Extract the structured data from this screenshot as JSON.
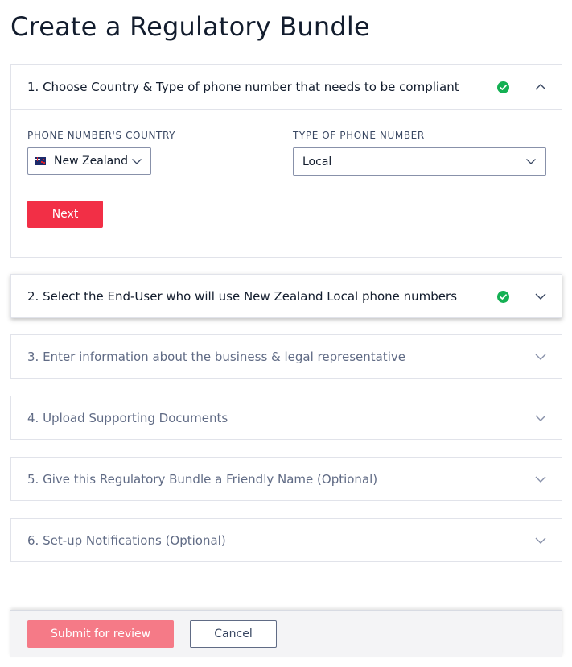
{
  "page": {
    "title": "Create a Regulatory Bundle"
  },
  "colors": {
    "brand_red": "#f22f46",
    "submit_disabled": "#f57a87",
    "success_green": "#14b053",
    "border": "#e1e3ea",
    "muted_text": "#606b85"
  },
  "sections": [
    {
      "label": "1. Choose Country & Type of phone number that needs to be compliant",
      "complete": true,
      "expanded": true,
      "icons": [
        "check-circle-icon",
        "chevron-up-icon"
      ],
      "body": {
        "country_label": "PHONE NUMBER'S COUNTRY",
        "country_value": "New Zealand",
        "country_flag": "new-zealand-flag-icon",
        "type_label": "TYPE OF PHONE NUMBER",
        "type_value": "Local",
        "next_label": "Next"
      }
    },
    {
      "label": "2. Select the End-User who will use New Zealand Local phone numbers",
      "complete": true,
      "expanded": false,
      "icons": [
        "check-circle-icon",
        "chevron-down-icon"
      ]
    },
    {
      "label": "3. Enter information about the business & legal representative",
      "complete": false,
      "expanded": false,
      "icons": [
        "chevron-down-icon"
      ]
    },
    {
      "label": "4. Upload Supporting Documents",
      "complete": false,
      "expanded": false,
      "icons": [
        "chevron-down-icon"
      ]
    },
    {
      "label": "5. Give this Regulatory Bundle a Friendly Name (Optional)",
      "complete": false,
      "expanded": false,
      "icons": [
        "chevron-down-icon"
      ]
    },
    {
      "label": "6. Set-up Notifications (Optional)",
      "complete": false,
      "expanded": false,
      "icons": [
        "chevron-down-icon"
      ]
    }
  ],
  "footer": {
    "submit_label": "Submit for review",
    "cancel_label": "Cancel"
  }
}
